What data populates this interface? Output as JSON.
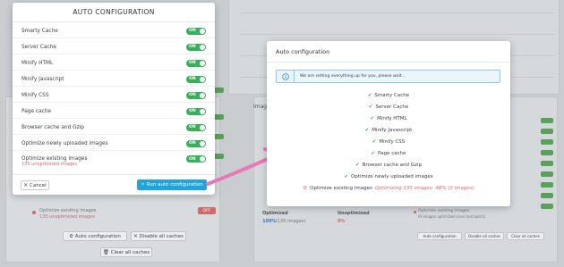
{
  "modal_left": {
    "title": "AUTO CONFIGURATION",
    "settings": [
      {
        "label": "Smarty Cache",
        "toggle": "ON"
      },
      {
        "label": "Server Cache",
        "toggle": "ON"
      },
      {
        "label": "Minify HTML",
        "toggle": "ON"
      },
      {
        "label": "Minify Javascript",
        "toggle": "ON"
      },
      {
        "label": "Minify CSS",
        "toggle": "ON"
      },
      {
        "label": "Page cache",
        "toggle": "ON"
      },
      {
        "label": "Browser cache and Gzip",
        "toggle": "ON"
      },
      {
        "label": "Optimize newly uploaded images",
        "toggle": "ON"
      },
      {
        "label": "Optimize existing images",
        "sub": "135 unoptimized images",
        "toggle": "ON"
      }
    ],
    "cancel_label": "Cancel",
    "run_label": "Run auto configuration"
  },
  "modal_right": {
    "title": "Auto configuration",
    "info_text": "We are setting everything up for you, please wait...",
    "steps": [
      "Smarty Cache",
      "Server Cache",
      "Minify HTML",
      "Minify Javascript",
      "Minify CSS",
      "Page cache",
      "Browser cache and Gzip",
      "Optimize newly uploaded images"
    ],
    "current_step": {
      "label": "Optimize existing images",
      "progress": "Optimizing 135 images: 48% (3 images)"
    }
  },
  "background": {
    "left_card": {
      "item_label": "Optimize existing images",
      "item_sub": "135 unoptimized images",
      "item_toggle": "OFF",
      "auto_config_button": "Auto configuration",
      "disable_all_button": "Disable all caches",
      "clear_all_button": "Clear all caches"
    },
    "right_card": {
      "title": "Image",
      "optimized_label": "Optimized",
      "optimized_value": "100%",
      "optimized_sub": "(135 images)",
      "unoptimized_label": "Unoptimized",
      "unoptimized_value": "0%",
      "item_label": "Optimize existing images",
      "item_sub": "(0 images optimized since last batch)",
      "auto_config_button": "Auto configuration",
      "disable_all_button": "Disable all caches",
      "clear_all_button": "Clear all caches"
    }
  },
  "colors": {
    "toggle_on": "#34b15a",
    "primary_button": "#1fa4dd",
    "warning_text": "#e46a6a",
    "arrow": "#e879b9"
  },
  "icons": {
    "check": "check-icon",
    "info": "info-icon",
    "cancel": "close-icon",
    "run": "magic-wand-icon",
    "spinner": "spinner-icon"
  }
}
